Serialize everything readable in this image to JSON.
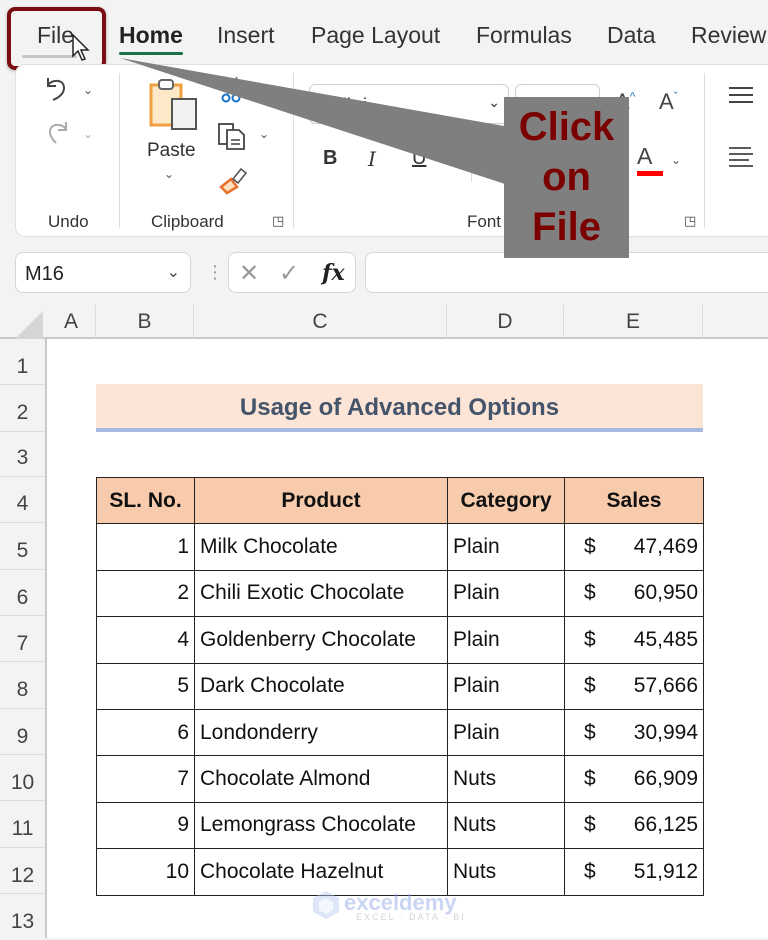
{
  "ribbon_tabs": [
    {
      "label": "File",
      "active": false
    },
    {
      "label": "Home",
      "active": true
    },
    {
      "label": "Insert",
      "active": false
    },
    {
      "label": "Page Layout",
      "active": false
    },
    {
      "label": "Formulas",
      "active": false
    },
    {
      "label": "Data",
      "active": false
    },
    {
      "label": "Review",
      "active": false
    }
  ],
  "ribbon": {
    "undo_group": {
      "label": "Undo",
      "undo_icon": "undo-icon",
      "redo_icon": "redo-icon"
    },
    "clipboard_group": {
      "label": "Clipboard",
      "paste_label": "Paste",
      "icons": [
        "paste-icon",
        "cut-icon",
        "copy-icon",
        "format-painter-icon"
      ]
    },
    "font_group": {
      "label": "Font",
      "font_name": "Calibri",
      "font_size": "",
      "bold": "B",
      "italic": "I",
      "underline": "U",
      "grow_font": "A",
      "shrink_font": "A",
      "font_color_label": "A",
      "font_color": "#ff0000"
    },
    "alignment_icons": [
      "align-top-icon",
      "align-left-icon"
    ]
  },
  "formula_bar": {
    "name_box": "M16",
    "cancel_glyph": "✕",
    "enter_glyph": "✓",
    "fx_label": "fx",
    "formula": ""
  },
  "columns": [
    "A",
    "B",
    "C",
    "D",
    "E"
  ],
  "rows": [
    "1",
    "2",
    "3",
    "4",
    "5",
    "6",
    "7",
    "8",
    "9",
    "10",
    "11",
    "12",
    "13"
  ],
  "sheet": {
    "title": "Usage of Advanced Options",
    "headers": [
      "SL. No.",
      "Product",
      "Category",
      "Sales"
    ],
    "currency_symbol": "$",
    "records": [
      {
        "sl": "1",
        "product": "Milk Chocolate",
        "category": "Plain",
        "sales": "47,469"
      },
      {
        "sl": "2",
        "product": "Chili Exotic Chocolate",
        "category": "Plain",
        "sales": "60,950"
      },
      {
        "sl": "4",
        "product": "Goldenberry Chocolate",
        "category": "Plain",
        "sales": "45,485"
      },
      {
        "sl": "5",
        "product": "Dark Chocolate",
        "category": "Plain",
        "sales": "57,666"
      },
      {
        "sl": "6",
        "product": "Londonderry",
        "category": "Plain",
        "sales": "30,994"
      },
      {
        "sl": "7",
        "product": "Chocolate Almond",
        "category": "Nuts",
        "sales": "66,909"
      },
      {
        "sl": "9",
        "product": "Lemongrass Chocolate",
        "category": "Nuts",
        "sales": "66,125"
      },
      {
        "sl": "10",
        "product": "Chocolate Hazelnut",
        "category": "Nuts",
        "sales": "51,912"
      }
    ]
  },
  "callout": {
    "lines": [
      "Click",
      "on",
      "File"
    ],
    "text_color": "#7b0000",
    "box_color": "#7f7f7f"
  },
  "watermark": {
    "name": "exceldemy",
    "tagline": "EXCEL · DATA · BI"
  },
  "colors": {
    "header_fill": "#f8cbad",
    "title_fill": "#fce4d6",
    "title_text": "#44546a",
    "title_underline": "#a9b8e0",
    "highlight_border": "#7b0e11",
    "home_tab_underline": "#1e7145"
  }
}
